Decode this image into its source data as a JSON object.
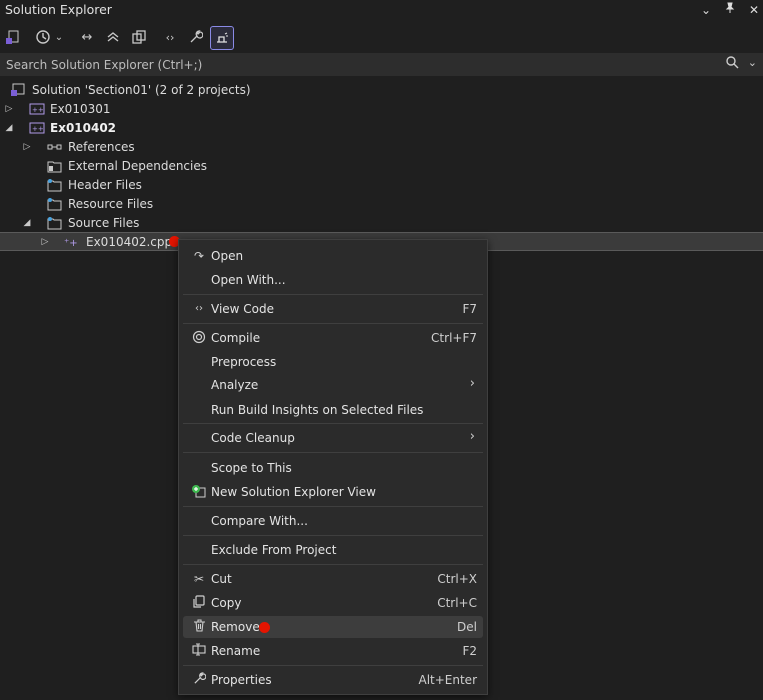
{
  "window": {
    "title": "Solution Explorer"
  },
  "search": {
    "placeholder": "Search Solution Explorer (Ctrl+;)"
  },
  "tree": {
    "solution": "Solution 'Section01'   (2 of 2 projects)",
    "project1": "Ex010301",
    "project2": "Ex010402",
    "references": "References",
    "external": "External Dependencies",
    "header": "Header Files",
    "resource": "Resource Files",
    "source": "Source Files",
    "file": "Ex010402.cpp"
  },
  "menu": {
    "open": "Open",
    "open_with": "Open With...",
    "view_code": "View Code",
    "view_code_key": "F7",
    "compile": "Compile",
    "compile_key": "Ctrl+F7",
    "preprocess": "Preprocess",
    "analyze": "Analyze",
    "run_build": "Run Build Insights on Selected Files",
    "code_cleanup": "Code Cleanup",
    "scope": "Scope to This",
    "new_view": "New Solution Explorer View",
    "compare": "Compare With...",
    "exclude": "Exclude From Project",
    "cut": "Cut",
    "cut_key": "Ctrl+X",
    "copy": "Copy",
    "copy_key": "Ctrl+C",
    "remove": "Remove",
    "remove_key": "Del",
    "rename": "Rename",
    "rename_key": "F2",
    "properties": "Properties",
    "properties_key": "Alt+Enter"
  },
  "colors": {
    "background": "#1f1f1f",
    "menu_bg": "#2b2b2b",
    "marker": "#e51400",
    "accent": "#8a8ae6"
  }
}
